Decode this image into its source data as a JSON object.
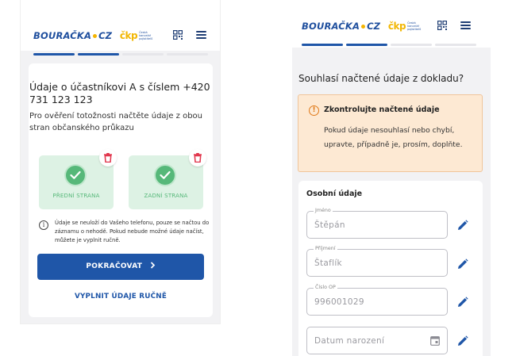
{
  "brand": {
    "name": "BOURAČKA",
    "tld": "CZ",
    "partner": "čkp",
    "partner_sub": "Česká kancelář pojistitelů"
  },
  "colors": {
    "primary": "#1f56a8",
    "success": "#56b879",
    "success_bg": "#ddf2e4",
    "danger": "#e0334a",
    "warning": "#e07a1a",
    "warning_bg": "#fde9d3"
  },
  "left": {
    "progress": {
      "total": 4,
      "completed": 2
    },
    "title": "Údaje o účastníkovi A s číslem +420 731 123 123",
    "subtitle": "Pro ověření totožnosti načtěte údaje z obou stran občanského průkazu",
    "documents": [
      {
        "label": "PŘEDNÍ STRANA",
        "icon": "check-icon",
        "delete_icon": "trash-icon"
      },
      {
        "label": "ZADNÍ STRANA",
        "icon": "check-icon",
        "delete_icon": "trash-icon"
      }
    ],
    "info": "Údaje se neuloží do Vašeho telefonu, pouze se načtou do záznamu o nehodě. Pokud nebude možné údaje načíst, můžete je vyplnit ručně.",
    "continue_button": "POKRAČOVAT",
    "manual_button": "VYPLNIT ÚDAJE RUČNĚ"
  },
  "right": {
    "progress": {
      "total": 4,
      "completed": 2
    },
    "title": "Souhlasí načtené údaje z dokladu?",
    "warning": {
      "title": "Zkontrolujte načtené údaje",
      "body": "Pokud údaje nesouhlasí nebo chybí, upravte, případně je, prosím, doplňte."
    },
    "section_title": "Osobní údaje",
    "fields": [
      {
        "label": "Jméno",
        "value": "Štěpán",
        "edit_icon": "pencil-icon"
      },
      {
        "label": "Příjmení",
        "value": "Štaflík",
        "edit_icon": "pencil-icon"
      },
      {
        "label": "Číslo OP",
        "value": "996001029",
        "edit_icon": "pencil-icon"
      },
      {
        "label": "",
        "value": "Datum narození",
        "icon": "calendar-icon",
        "edit_icon": "pencil-icon"
      }
    ]
  }
}
